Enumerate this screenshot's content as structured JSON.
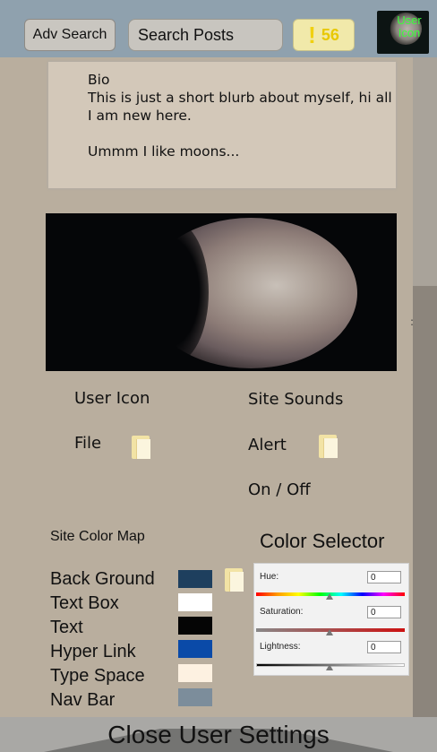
{
  "topbar": {
    "adv_search_label": "Adv Search",
    "search_placeholder": "Search Posts",
    "notifications": {
      "icon": "exclamation-icon",
      "symbol": "!",
      "count": "56"
    },
    "user_icon_label": "User Icon"
  },
  "bio": {
    "text": "Bio\nThis is just a short blurb about myself, hi all I am new here.\n\nUmmm I like moons..."
  },
  "profile_image": {
    "icon": "moon-image"
  },
  "user_icon_section": {
    "title": "User Icon",
    "file_label": "File"
  },
  "site_sounds": {
    "title": "Site Sounds",
    "alert_label": "Alert",
    "toggle_label": "On / Off"
  },
  "color_map": {
    "title": "Site Color Map",
    "items": [
      {
        "label": "Back Ground",
        "color": "#1e3f5e"
      },
      {
        "label": "Text Box",
        "color": "#ffffff"
      },
      {
        "label": "Text",
        "color": "#050505"
      },
      {
        "label": "Hyper Link",
        "color": "#0a4aa8"
      },
      {
        "label": "Type Space",
        "color": "#fdf1e1"
      },
      {
        "label": "Nav Bar",
        "color": "#7c8d9b"
      }
    ]
  },
  "color_selector": {
    "title": "Color Selector",
    "hue": {
      "label": "Hue:",
      "value": "0"
    },
    "saturation": {
      "label": "Saturation:",
      "value": "0"
    },
    "lightness": {
      "label": "Lightness:",
      "value": "0"
    }
  },
  "footer": {
    "close_label": "Close User Settings"
  },
  "colors": {
    "topbar": "#8fa1ae",
    "background": "#b9ae9e",
    "user_icon_text": "#3bff3b",
    "notif_accent": "#e8c800"
  }
}
